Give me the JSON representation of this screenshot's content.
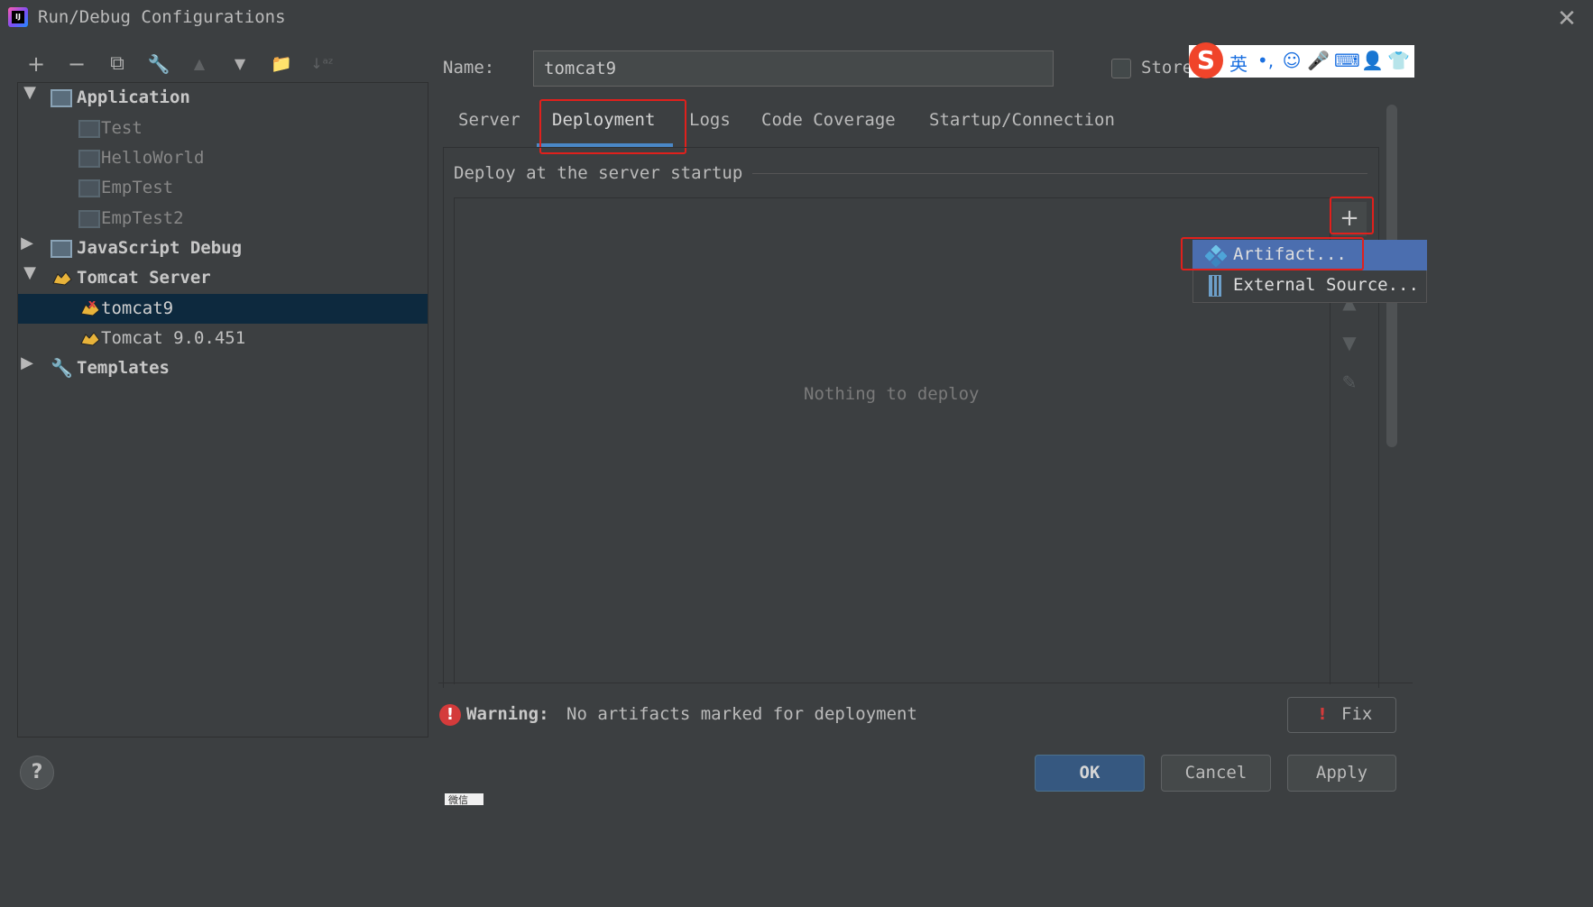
{
  "window": {
    "title": "Run/Debug Configurations"
  },
  "toolbar": {
    "add": "+",
    "remove": "−",
    "copy": "⧉",
    "edit": "🔧",
    "up": "▲",
    "down": "▼",
    "folder": "📁",
    "sort": "↓ᵃᶻ"
  },
  "tree": {
    "application": "Application",
    "test": "Test",
    "helloworld": "HelloWorld",
    "emptest": "EmpTest",
    "emptest2": "EmpTest2",
    "jsdebug": "JavaScript Debug",
    "tomcat_server": "Tomcat Server",
    "tomcat9": "tomcat9",
    "tomcat_version": "Tomcat 9.0.451",
    "templates": "Templates"
  },
  "name_field": {
    "label": "Name:",
    "value": "tomcat9"
  },
  "store": {
    "label": "Store"
  },
  "ime": {
    "logo": "S",
    "lang": "英",
    "punct": "•,",
    "face": "☺",
    "mic": "🎤",
    "keyboard": "⌨",
    "user": "👤",
    "shirt": "👕"
  },
  "tabs": [
    "Server",
    "Deployment",
    "Logs",
    "Code Coverage",
    "Startup/Connection"
  ],
  "deploy": {
    "title": "Deploy at the server startup",
    "empty": "Nothing to deploy",
    "add": "+"
  },
  "popup": {
    "artifact": "Artifact...",
    "external": "External Source..."
  },
  "warning": {
    "strong": "Warning:",
    "text": "No artifacts marked for deployment"
  },
  "buttons": {
    "fix": "Fix",
    "ok": "OK",
    "cancel": "Cancel",
    "apply": "Apply",
    "help": "?"
  },
  "wechat": "微信",
  "colors": {
    "background": "#3c3f41",
    "selection": "#0d293e",
    "accent": "#4a88c7",
    "highlight_box": "#e0201c",
    "popup_selected": "#4b6eaf"
  }
}
